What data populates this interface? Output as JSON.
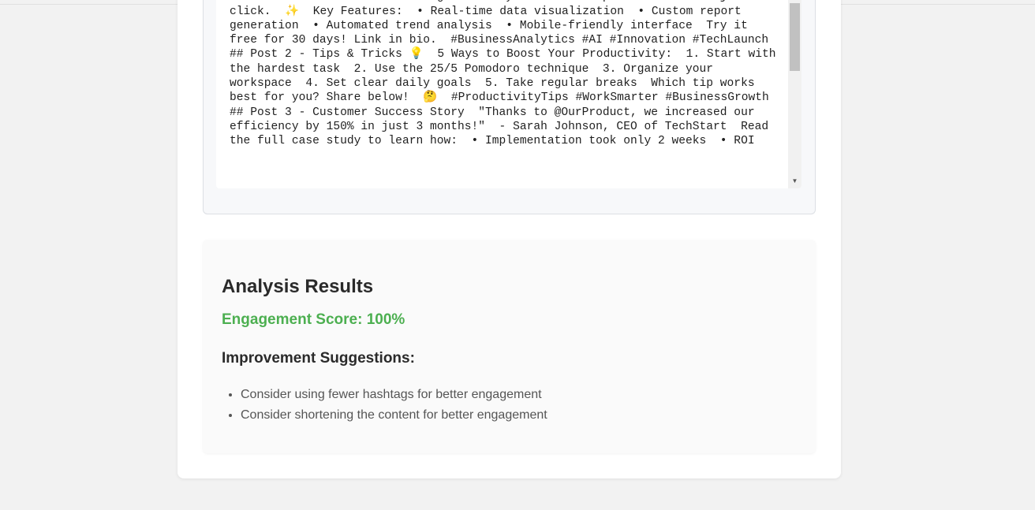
{
  "editor": {
    "content": "🎉 Big News: We're thrilled to introduce our new AI-powered analytics dashboard!  Get real-time insights into your business performance with just one click.  ✨  Key Features:  • Real-time data visualization  • Custom report generation  • Automated trend analysis  • Mobile-friendly interface  Try it free for 30 days! Link in bio.  #BusinessAnalytics #AI #Innovation #TechLaunch  ## Post 2 - Tips & Tricks 💡  5 Ways to Boost Your Productivity:  1. Start with the hardest task  2. Use the 25/5 Pomodoro technique  3. Organize your workspace  4. Set clear daily goals  5. Take regular breaks  Which tip works best for you? Share below!  🤔  #ProductivityTips #WorkSmarter #BusinessGrowth  ## Post 3 - Customer Success Story  \"Thanks to @OurProduct, we increased our efficiency by 150% in just 3 months!\"  - Sarah Johnson, CEO of TechStart  Read the full case study to learn how:  • Implementation took only 2 weeks  • ROI"
  },
  "results": {
    "title": "Analysis Results",
    "score_label": "Engagement Score: 100%",
    "suggestions_title": "Improvement Suggestions:",
    "suggestions": [
      "Consider using fewer hashtags for better engagement",
      "Consider shortening the content for better engagement"
    ]
  },
  "colors": {
    "score": "#4caf50",
    "page_background": "#f2f2f2"
  }
}
